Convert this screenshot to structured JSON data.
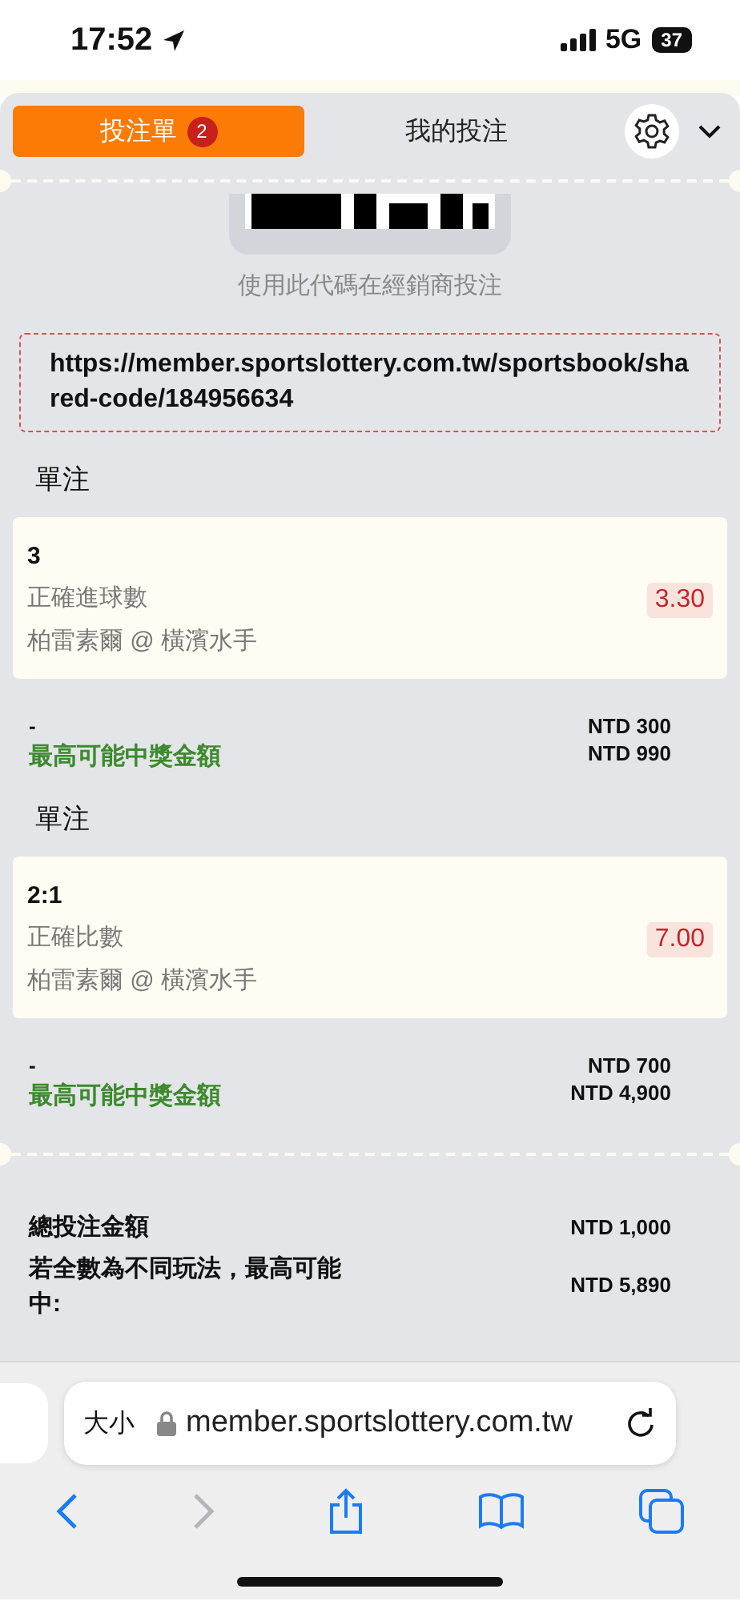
{
  "status_bar": {
    "time": "17:52",
    "network": "5G",
    "battery": "37"
  },
  "tabs": [
    {
      "label": "投注單",
      "badge": "2",
      "selected": true
    },
    {
      "label": "我的投注",
      "selected": false
    }
  ],
  "share": {
    "caption": "使用此代碼在經銷商投注",
    "url": "https://member.sportslottery.com.tw/sportsbook/shared-code/184956634"
  },
  "bets": [
    {
      "section": "單注",
      "selection": "3",
      "market": "正確進球數",
      "match": "柏雷素爾 @ 橫濱水手",
      "odds": "3.30",
      "stake_label": "-",
      "payout_label": "最高可能中獎金額",
      "stake": "NTD 300",
      "payout": "NTD 990"
    },
    {
      "section": "單注",
      "selection": "2:1",
      "market": "正確比數",
      "match": "柏雷素爾 @ 橫濱水手",
      "odds": "7.00",
      "stake_label": "-",
      "payout_label": "最高可能中獎金額",
      "stake": "NTD 700",
      "payout": "NTD 4,900"
    }
  ],
  "totals": [
    {
      "label": "總投注金額",
      "value": "NTD 1,000"
    },
    {
      "label": "若全數為不同玩法，最高可能中:",
      "value": "NTD 5,890"
    }
  ],
  "browser": {
    "text_size": "大小",
    "address": "member.sportslottery.com.tw"
  }
}
